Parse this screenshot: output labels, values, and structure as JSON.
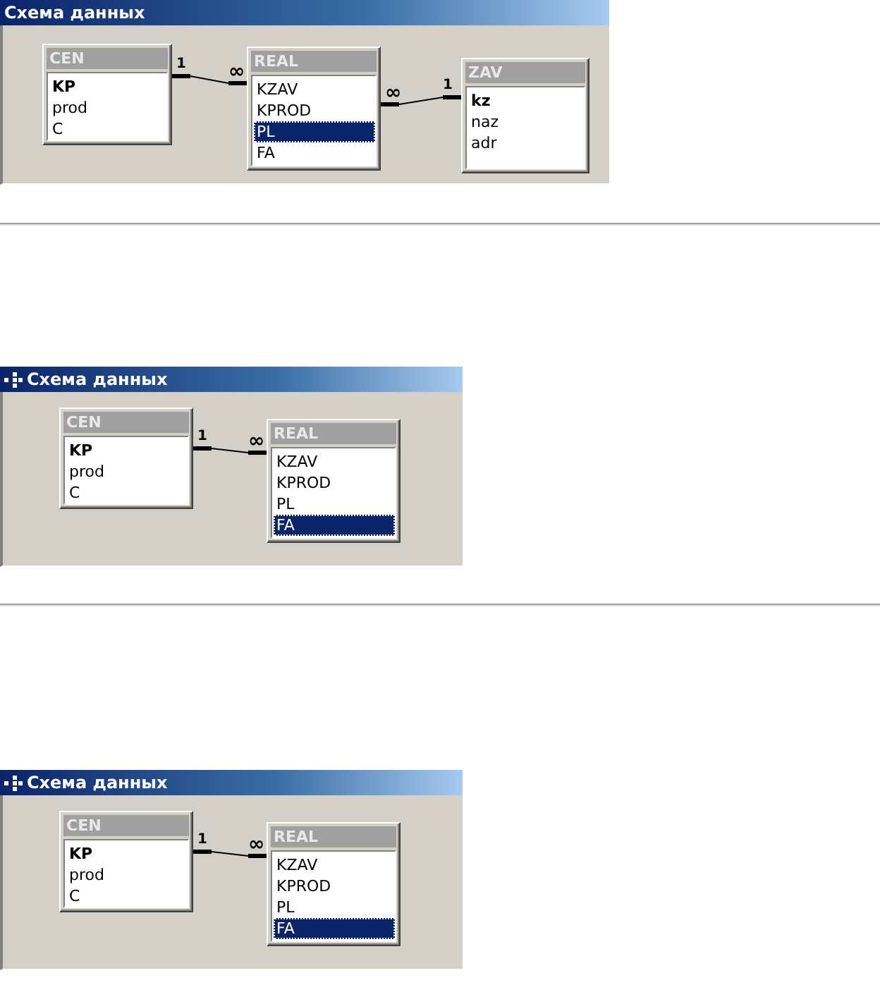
{
  "panels": [
    {
      "title": "Схема данных",
      "icon": false,
      "tables": [
        {
          "name": "CEN",
          "fields": [
            {
              "name": "KP",
              "key": true,
              "selected": false
            },
            {
              "name": "prod",
              "key": false,
              "selected": false
            },
            {
              "name": "C",
              "key": false,
              "selected": false
            }
          ]
        },
        {
          "name": "REAL",
          "fields": [
            {
              "name": "KZAV",
              "key": false,
              "selected": false
            },
            {
              "name": "KPROD",
              "key": false,
              "selected": false
            },
            {
              "name": "PL",
              "key": false,
              "selected": true
            },
            {
              "name": "FA",
              "key": false,
              "selected": false
            }
          ]
        },
        {
          "name": "ZAV",
          "fields": [
            {
              "name": "kz",
              "key": true,
              "selected": false
            },
            {
              "name": "naz",
              "key": false,
              "selected": false
            },
            {
              "name": "adr",
              "key": false,
              "selected": false
            }
          ]
        }
      ],
      "relations": [
        {
          "left_label": "1",
          "right_label": "∞"
        },
        {
          "left_label": "∞",
          "right_label": "1"
        }
      ]
    },
    {
      "title": "Схема данных",
      "icon": true,
      "tables": [
        {
          "name": "CEN",
          "fields": [
            {
              "name": "KP",
              "key": true,
              "selected": false
            },
            {
              "name": "prod",
              "key": false,
              "selected": false
            },
            {
              "name": "C",
              "key": false,
              "selected": false
            }
          ]
        },
        {
          "name": "REAL",
          "fields": [
            {
              "name": "KZAV",
              "key": false,
              "selected": false
            },
            {
              "name": "KPROD",
              "key": false,
              "selected": false
            },
            {
              "name": "PL",
              "key": false,
              "selected": false
            },
            {
              "name": "FA",
              "key": false,
              "selected": true
            }
          ]
        }
      ],
      "relations": [
        {
          "left_label": "1",
          "right_label": "∞"
        }
      ]
    },
    {
      "title": "Схема данных",
      "icon": true,
      "tables": [
        {
          "name": "CEN",
          "fields": [
            {
              "name": "KP",
              "key": true,
              "selected": false
            },
            {
              "name": "prod",
              "key": false,
              "selected": false
            },
            {
              "name": "C",
              "key": false,
              "selected": false
            }
          ]
        },
        {
          "name": "REAL",
          "fields": [
            {
              "name": "KZAV",
              "key": false,
              "selected": false
            },
            {
              "name": "KPROD",
              "key": false,
              "selected": false
            },
            {
              "name": "PL",
              "key": false,
              "selected": false
            },
            {
              "name": "FA",
              "key": false,
              "selected": true
            }
          ]
        }
      ],
      "relations": [
        {
          "left_label": "1",
          "right_label": "∞"
        }
      ]
    }
  ]
}
